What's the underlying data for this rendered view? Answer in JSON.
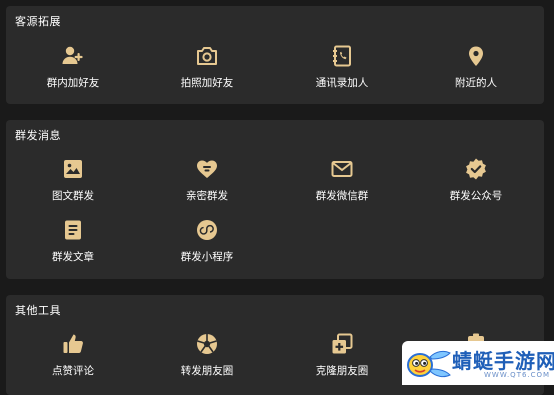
{
  "colors": {
    "background": "#1a1a1a",
    "card": "#2b2b2b",
    "icon_gold": "#e6c891",
    "text": "#ffffff"
  },
  "sections": [
    {
      "title": "客源拓展",
      "items": [
        {
          "label": "群内加好友",
          "icon": "add-friend-icon"
        },
        {
          "label": "拍照加好友",
          "icon": "camera-icon"
        },
        {
          "label": "通讯录加人",
          "icon": "contacts-book-icon"
        },
        {
          "label": "附近的人",
          "icon": "location-pin-icon"
        }
      ]
    },
    {
      "title": "群发消息",
      "items": [
        {
          "label": "图文群发",
          "icon": "image-text-icon"
        },
        {
          "label": "亲密群发",
          "icon": "heart-chat-icon"
        },
        {
          "label": "群发微信群",
          "icon": "envelope-icon"
        },
        {
          "label": "群发公众号",
          "icon": "verified-badge-icon"
        },
        {
          "label": "群发文章",
          "icon": "article-icon"
        },
        {
          "label": "群发小程序",
          "icon": "mini-program-icon"
        }
      ]
    },
    {
      "title": "其他工具",
      "items": [
        {
          "label": "点赞评论",
          "icon": "thumbs-up-icon"
        },
        {
          "label": "转发朋友圈",
          "icon": "aperture-icon"
        },
        {
          "label": "克隆朋友圈",
          "icon": "clone-icon"
        },
        {
          "label": "",
          "icon": "clipboard-icon"
        }
      ]
    }
  ],
  "watermark": {
    "text": "蜻蜓手游网",
    "url": "WWW.QT6.COM"
  }
}
